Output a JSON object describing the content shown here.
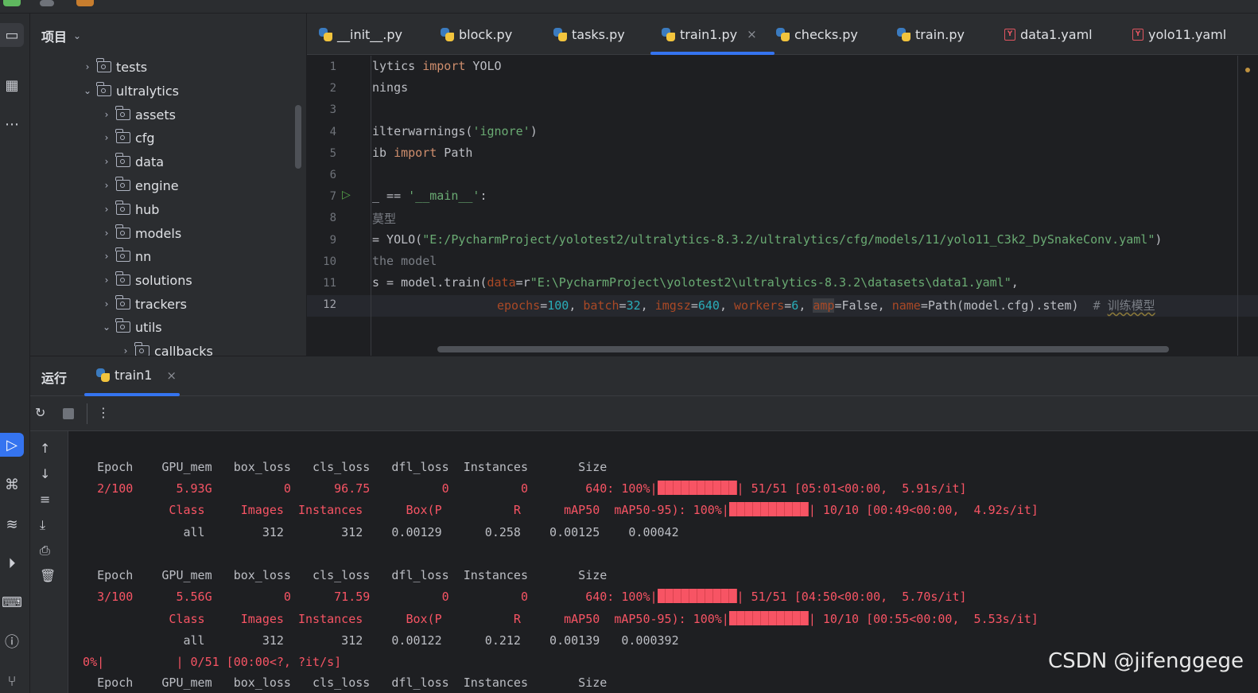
{
  "project": {
    "title": "项目",
    "tree": [
      {
        "label": "tests",
        "expanded": false
      },
      {
        "label": "ultralytics",
        "expanded": true
      },
      {
        "label": "assets",
        "expanded": false
      },
      {
        "label": "cfg",
        "expanded": false
      },
      {
        "label": "data",
        "expanded": false
      },
      {
        "label": "engine",
        "expanded": false
      },
      {
        "label": "hub",
        "expanded": false
      },
      {
        "label": "models",
        "expanded": false
      },
      {
        "label": "nn",
        "expanded": false
      },
      {
        "label": "solutions",
        "expanded": false
      },
      {
        "label": "trackers",
        "expanded": false
      },
      {
        "label": "utils",
        "expanded": true
      },
      {
        "label": "callbacks",
        "expanded": false
      }
    ]
  },
  "editor": {
    "tabs": [
      {
        "label": "__init__.py",
        "icon": "python-file-icon"
      },
      {
        "label": "block.py",
        "icon": "python-file-icon"
      },
      {
        "label": "tasks.py",
        "icon": "python-file-icon"
      },
      {
        "label": "train1.py",
        "icon": "python-file-icon",
        "active": true
      },
      {
        "label": "checks.py",
        "icon": "python-file-icon"
      },
      {
        "label": "train.py",
        "icon": "python-file-icon"
      },
      {
        "label": "data1.yaml",
        "icon": "yaml-file-icon"
      },
      {
        "label": "yolo11.yaml",
        "icon": "yaml-file-icon"
      }
    ],
    "yaml_icon_letter": "Y",
    "line_numbers": [
      "1",
      "2",
      "3",
      "4",
      "5",
      "6",
      "7",
      "8",
      "9",
      "10",
      "11",
      "12"
    ],
    "current_line": "12",
    "code": {
      "l1_a": "lytics ",
      "l1_kw": "import",
      "l1_b": " YOLO",
      "l2": "nings",
      "l4_a": "ilterwarnings(",
      "l4_str": "'ignore'",
      "l4_b": ")",
      "l5_a": "ib ",
      "l5_kw": "import",
      "l5_b": " Path",
      "l7_a": "_ == ",
      "l7_str": "'__main__'",
      "l7_b": ":",
      "l8": "莫型",
      "l9_a": "= YOLO(",
      "l9_str": "\"E:/PycharmProject/yolotest2/ultralytics-8.3.2/ultralytics/cfg/models/11/yolo11_C3k2_DySnakeConv.yaml\"",
      "l9_b": ")",
      "l10": "the model",
      "l11_a": "s = model.train(",
      "l11_p": "data",
      "l11_b": "=r",
      "l11_str": "\"E:\\PycharmProject\\yolotest2\\ultralytics-8.3.2\\datasets\\data1.yaml\"",
      "l11_c": ",",
      "l12_p1": "epochs",
      "l12_eq1": "=",
      "l12_n1": "100",
      "l12_s1": ", ",
      "l12_p2": "batch",
      "l12_eq2": "=",
      "l12_n2": "32",
      "l12_s2": ", ",
      "l12_p3": "imgsz",
      "l12_eq3": "=",
      "l12_n3": "640",
      "l12_s3": ", ",
      "l12_p4": "workers",
      "l12_eq4": "=",
      "l12_n4": "6",
      "l12_s4": ", ",
      "l12_p5": "amp",
      "l12_eq5": "=False, ",
      "l12_p6": "name",
      "l12_eq6": "=Path(model.cfg).stem)  ",
      "l12_cmt1": "# ",
      "l12_cmt2": "训练模型"
    }
  },
  "run": {
    "title": "运行",
    "tab_label": "train1",
    "console": {
      "header": "    Epoch    GPU_mem   box_loss   cls_loss   dfl_loss  Instances       Size",
      "epochs": [
        {
          "train_line_a": "    2/100      5.93G          0      96.75          0          0        640: 100%|",
          "train_line_b": "| 51/51 [05:01<00:00,  5.91s/it]",
          "val_line_a": "              Class     Images  Instances      Box(P          R      mAP50  mAP50-95): 100%|",
          "val_line_b": "| 10/10 [00:49<00:00,  4.92s/it]",
          "result_line": "                all        312        312    0.00129      0.258    0.00125    0.00042"
        },
        {
          "train_line_a": "    3/100      5.56G          0      71.59          0          0        640: 100%|",
          "train_line_b": "| 51/51 [04:50<00:00,  5.70s/it]",
          "val_line_a": "              Class     Images  Instances      Box(P          R      mAP50  mAP50-95): 100%|",
          "val_line_b": "| 10/10 [00:55<00:00,  5.53s/it]",
          "result_line": "                all        312        312    0.00122      0.212    0.00139   0.000392"
        }
      ],
      "progress_line": "  0%|          | 0/51 [00:00<?, ?it/s]",
      "last_header": "    Epoch    GPU_mem   box_loss   cls_loss   dfl_loss  Instances       Size"
    }
  },
  "watermark": "CSDN @jifenggege"
}
